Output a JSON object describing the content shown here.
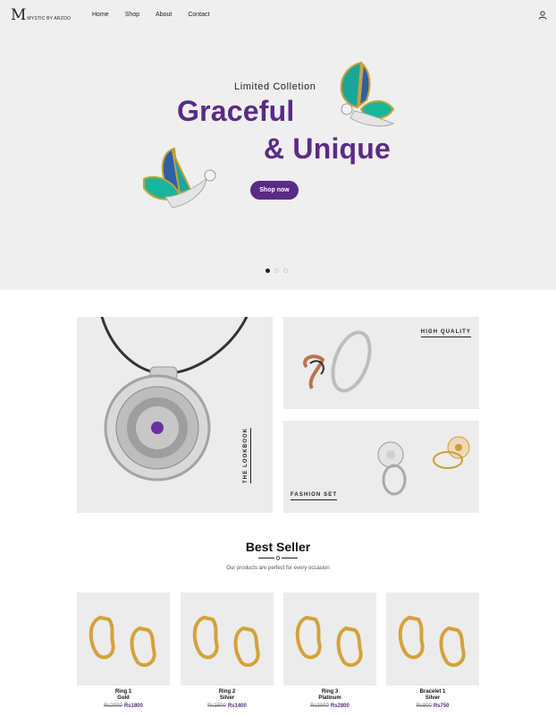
{
  "brand": {
    "mark": "M",
    "name": "MYSTIC BY ARZOO"
  },
  "nav": {
    "items": [
      "Home",
      "Shop",
      "About",
      "Contact"
    ]
  },
  "icons": {
    "user": "user-icon"
  },
  "hero": {
    "kicker": "Limited Colletion",
    "title_line1": "Graceful",
    "title_line2": "& Unique",
    "button": "Shop now",
    "slide_count": 3,
    "active_slide": 1
  },
  "tiles": {
    "lookbook": "THE LOOKBOOK",
    "quality": "HIGH QUALITY",
    "fashion": "FASHION SET"
  },
  "best_seller": {
    "title": "Best Seller",
    "subtitle": "Our products are perfect for every occasion",
    "products": [
      {
        "name": "Ring 1",
        "material": "Gold",
        "old_price": "Rs2000",
        "price": "Rs1800"
      },
      {
        "name": "Ring 2",
        "material": "Silver",
        "old_price": "Rs1500",
        "price": "Rs1400"
      },
      {
        "name": "Ring 3",
        "material": "Platinum",
        "old_price": "Rs3000",
        "price": "Rs2800"
      },
      {
        "name": "Bracelet 1",
        "material": "Silver",
        "old_price": "Rs800",
        "price": "Rs750"
      }
    ]
  },
  "colors": {
    "accent": "#5b2a86",
    "panel": "#ececec",
    "hero_bg": "#efefef"
  }
}
